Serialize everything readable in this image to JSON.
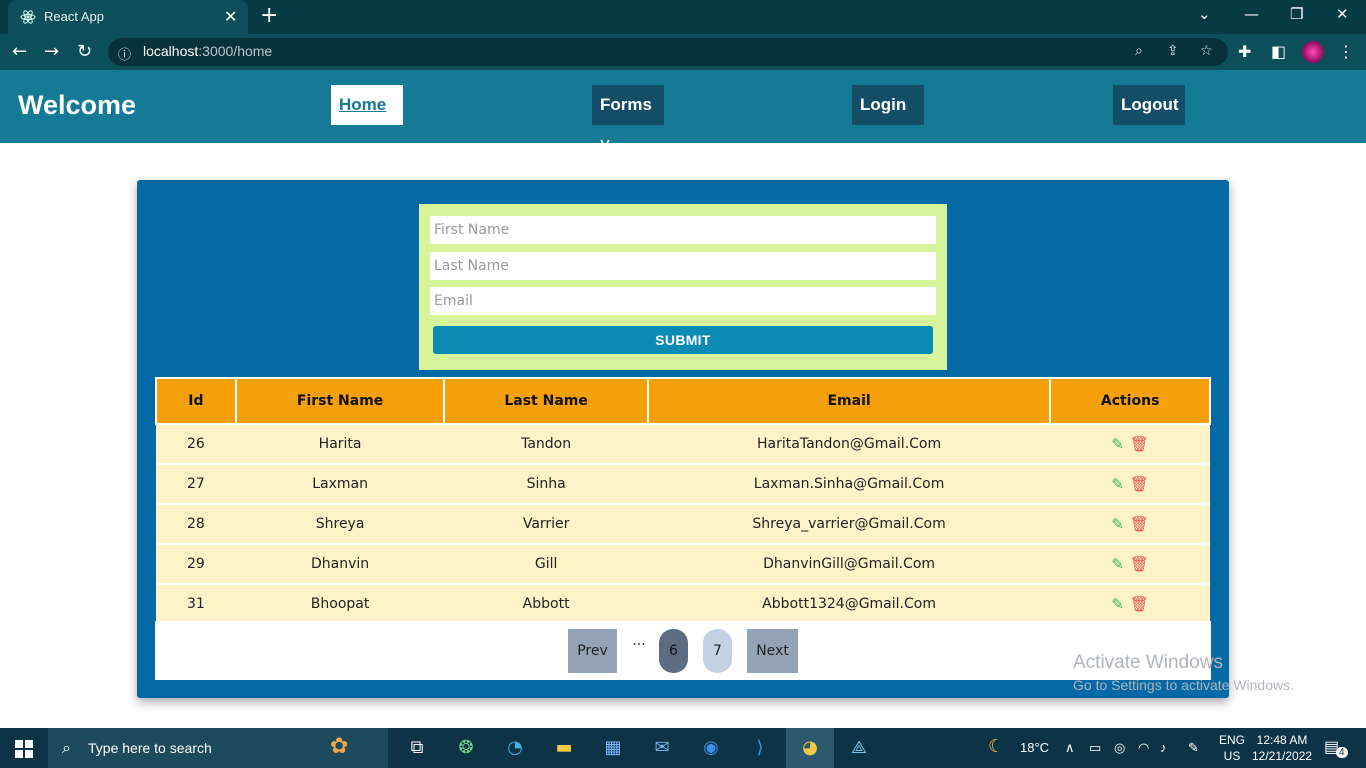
{
  "browser": {
    "tab_title": "React App",
    "url_host": "localhost",
    "url_rest": ":3000/home"
  },
  "navbar": {
    "brand": "Welcome",
    "links": [
      {
        "label": "Home"
      },
      {
        "label": "Forms ˅"
      },
      {
        "label": "Login"
      },
      {
        "label": "Logout"
      }
    ]
  },
  "form": {
    "first_name_placeholder": "First Name",
    "last_name_placeholder": "Last Name",
    "email_placeholder": "Email",
    "submit_label": "SUBMIT"
  },
  "table": {
    "headers": [
      "Id",
      "First Name",
      "Last Name",
      "Email",
      "Actions"
    ],
    "rows": [
      {
        "id": "26",
        "first": "Harita",
        "last": "Tandon",
        "email": "HaritaTandon@Gmail.Com"
      },
      {
        "id": "27",
        "first": "Laxman",
        "last": "Sinha",
        "email": "Laxman.Sinha@Gmail.Com"
      },
      {
        "id": "28",
        "first": "Shreya",
        "last": "Varrier",
        "email": "Shreya_varrier@Gmail.Com"
      },
      {
        "id": "29",
        "first": "Dhanvin",
        "last": "Gill",
        "email": "DhanvinGill@Gmail.Com"
      },
      {
        "id": "31",
        "first": "Bhoopat",
        "last": "Abbott",
        "email": "Abbott1324@Gmail.Com"
      }
    ]
  },
  "pagination": {
    "prev": "Prev",
    "ellipsis": "...",
    "pages": [
      "6",
      "7"
    ],
    "current_page": "6",
    "next": "Next"
  },
  "watermark": {
    "line1": "Activate Windows",
    "line2": "Go to Settings to activate Windows."
  },
  "taskbar": {
    "search_placeholder": "Type here to search",
    "weather": "18°C",
    "lang1": "ENG",
    "lang2": "US",
    "time": "12:48 AM",
    "date": "12/21/2022",
    "notifications": "4"
  },
  "colors": {
    "navbar": "#147a96",
    "card": "#0469a5",
    "form_bg": "#d8f49b",
    "header_bg": "#f5a00b",
    "row_bg": "#fef3c8"
  }
}
